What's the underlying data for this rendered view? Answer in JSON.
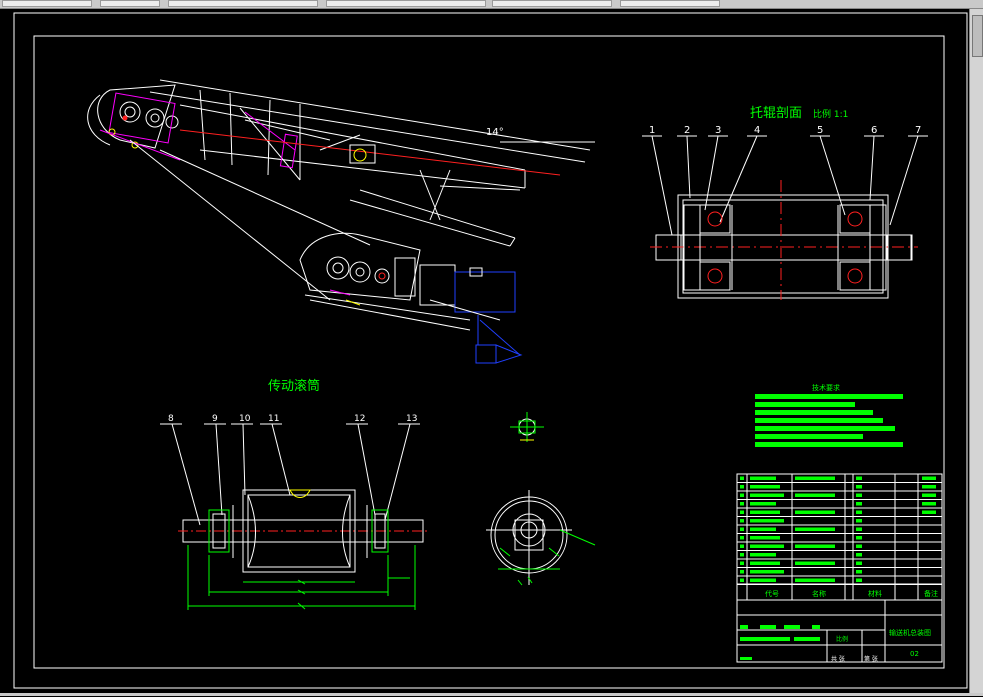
{
  "views": {
    "idler_title": "托辊剖面",
    "idler_scale": "比例 1:1",
    "drum_title": "传动滚筒",
    "angle_label": "14°"
  },
  "idler_balloons": [
    "1",
    "2",
    "3",
    "4",
    "5",
    "6",
    "7"
  ],
  "drum_balloons": [
    "8",
    "9",
    "10",
    "11",
    "12",
    "13"
  ],
  "notes": {
    "heading": "技术要求"
  },
  "title_block": {
    "col_code": "代号",
    "col_name": "名称",
    "col_material": "材料",
    "col_remark": "备注",
    "drawing_name": "输送机总装图",
    "drawing_no": "02",
    "scale_label": "比例",
    "sheet_total": "共 张",
    "sheet_no": "第 张"
  },
  "colors": {
    "line": "#ffffff",
    "dim": "#00ff00",
    "center": "#ff2020",
    "magenta": "#ff00ff",
    "blue": "#2040ff",
    "yellow": "#ffff00",
    "title": "#00ff00"
  }
}
